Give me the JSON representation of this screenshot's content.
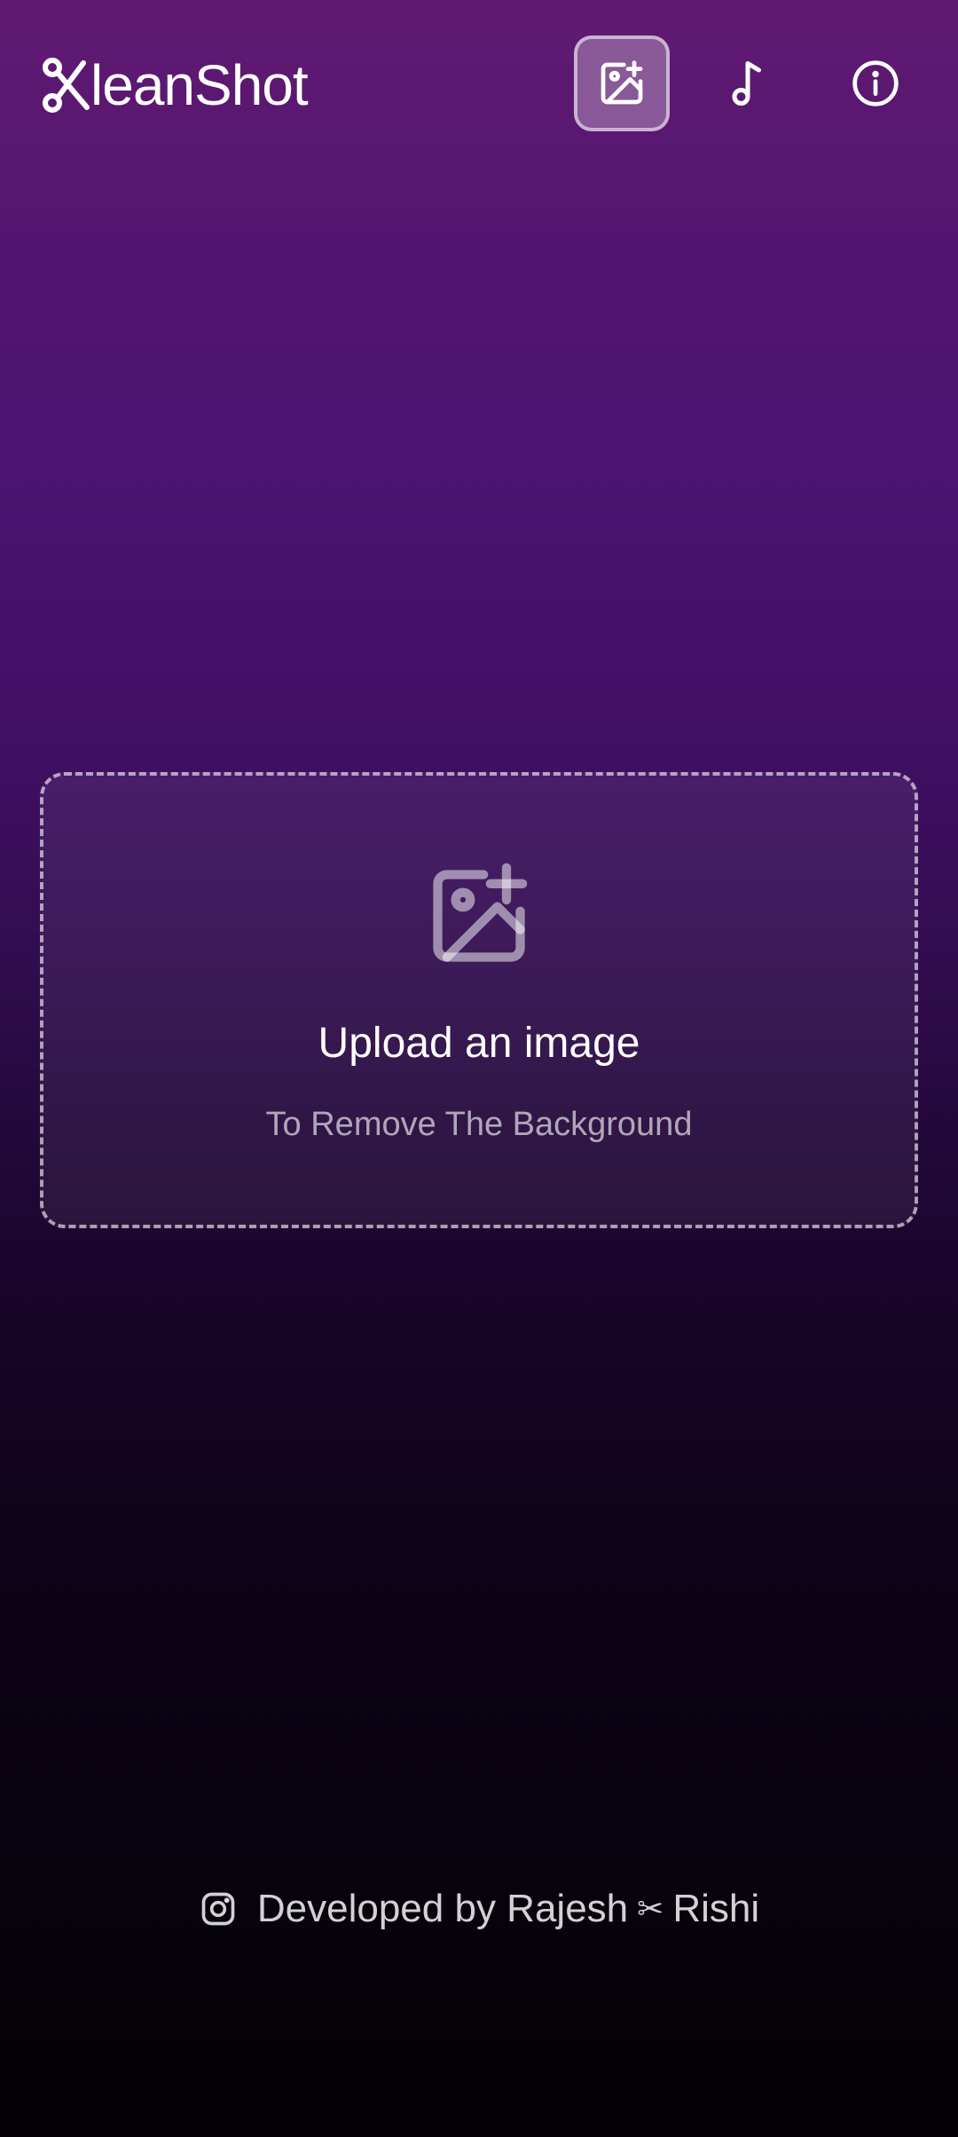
{
  "header": {
    "logo_text": "leanShot",
    "icons": {
      "logo_mark": "scissors-k-icon",
      "upload": "image-plus-icon",
      "music": "music-note-icon",
      "info": "info-icon"
    }
  },
  "upload": {
    "icon": "image-plus-icon",
    "title": "Upload an image",
    "subtitle": "To Remove The Background"
  },
  "footer": {
    "icon": "instagram-icon",
    "prefix": "Developed by Rajesh",
    "separator": "✂",
    "suffix": "Rishi"
  },
  "colors": {
    "background_top": "#611a72",
    "background_mid": "#3f0f62",
    "background_bottom": "#030104",
    "active_button_bg": "rgba(255,255,255,0.28)"
  }
}
